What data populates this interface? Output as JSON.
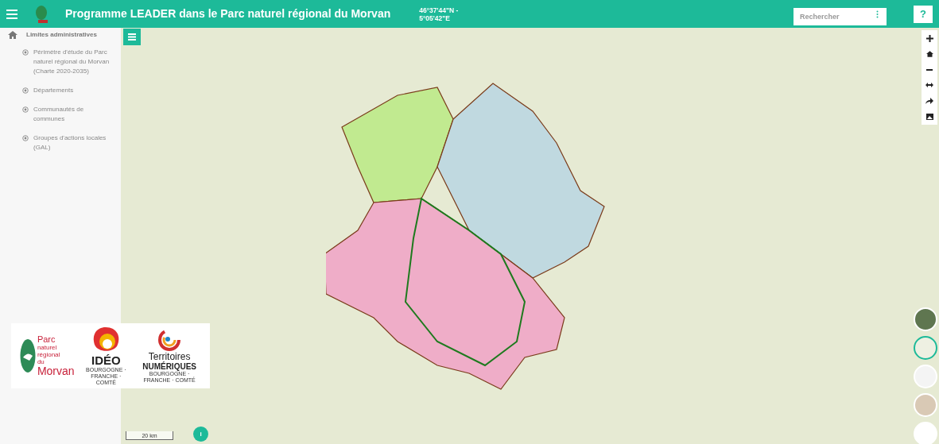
{
  "header": {
    "title": "Programme LEADER dans le Parc naturel régional du Morvan",
    "coordinates": [
      "46°37'44\"N -",
      "5°05'42\"E"
    ],
    "search": {
      "placeholder": "Rechercher"
    },
    "help": "?"
  },
  "sidebar": {
    "group": "Limites administratives",
    "items": [
      {
        "label": "Périmètre d'étude du Parc naturel régional du Morvan (Charte 2020-2035)"
      },
      {
        "label": "Départements"
      },
      {
        "label": "Communautés de communes"
      },
      {
        "label": "Groupes d'actions locales (GAL)"
      }
    ]
  },
  "logos": {
    "parc": [
      "Parc",
      "naturel",
      "régional",
      "du",
      "Morvan"
    ],
    "ideo": {
      "name": "IDÉO",
      "region": "BOURGOGNE · FRANCHE · COMTÉ"
    },
    "territoires": {
      "line1": "Territoires",
      "line2": "NUMÉRIQUES",
      "region": "BOURGOGNE · FRANCHE · COMTÉ"
    }
  },
  "map": {
    "scale": "20 km",
    "info": "i",
    "basemaps": [
      {
        "kind": "satellite",
        "selected": false
      },
      {
        "kind": "streets",
        "selected": true
      },
      {
        "kind": "blank",
        "selected": false
      },
      {
        "kind": "geology",
        "selected": false
      },
      {
        "kind": "labels",
        "selected": false
      }
    ]
  }
}
